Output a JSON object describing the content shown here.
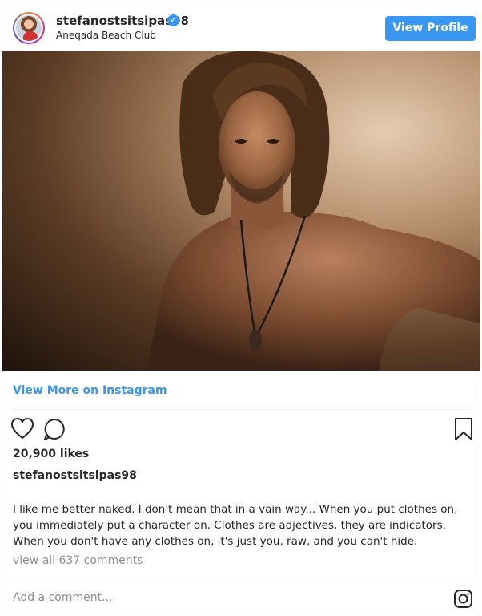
{
  "header": {
    "username": "stefanostsitsipas98",
    "location": "Aneqada Beach Club",
    "view_profile_label": "View Profile"
  },
  "post": {
    "view_more_label": "View More on Instagram",
    "likes": "20,900 likes",
    "owner": "stefanostsitsipas98",
    "caption": "I like me better naked. I don't mean that in a vain way... When you put clothes on, you immediately put a character on. Clothes are adjectives, they are indicators. When you don't have any clothes on, it's just you, raw, and you can't hide.",
    "view_comments": "view all 637 comments",
    "add_comment_placeholder": "Add a comment..."
  },
  "colors": {
    "accent": "#3897f0",
    "text": "#262626",
    "muted": "#8e8e8e"
  },
  "icons": [
    "verified-badge-icon",
    "heart-icon",
    "comment-icon",
    "bookmark-icon",
    "instagram-icon"
  ]
}
